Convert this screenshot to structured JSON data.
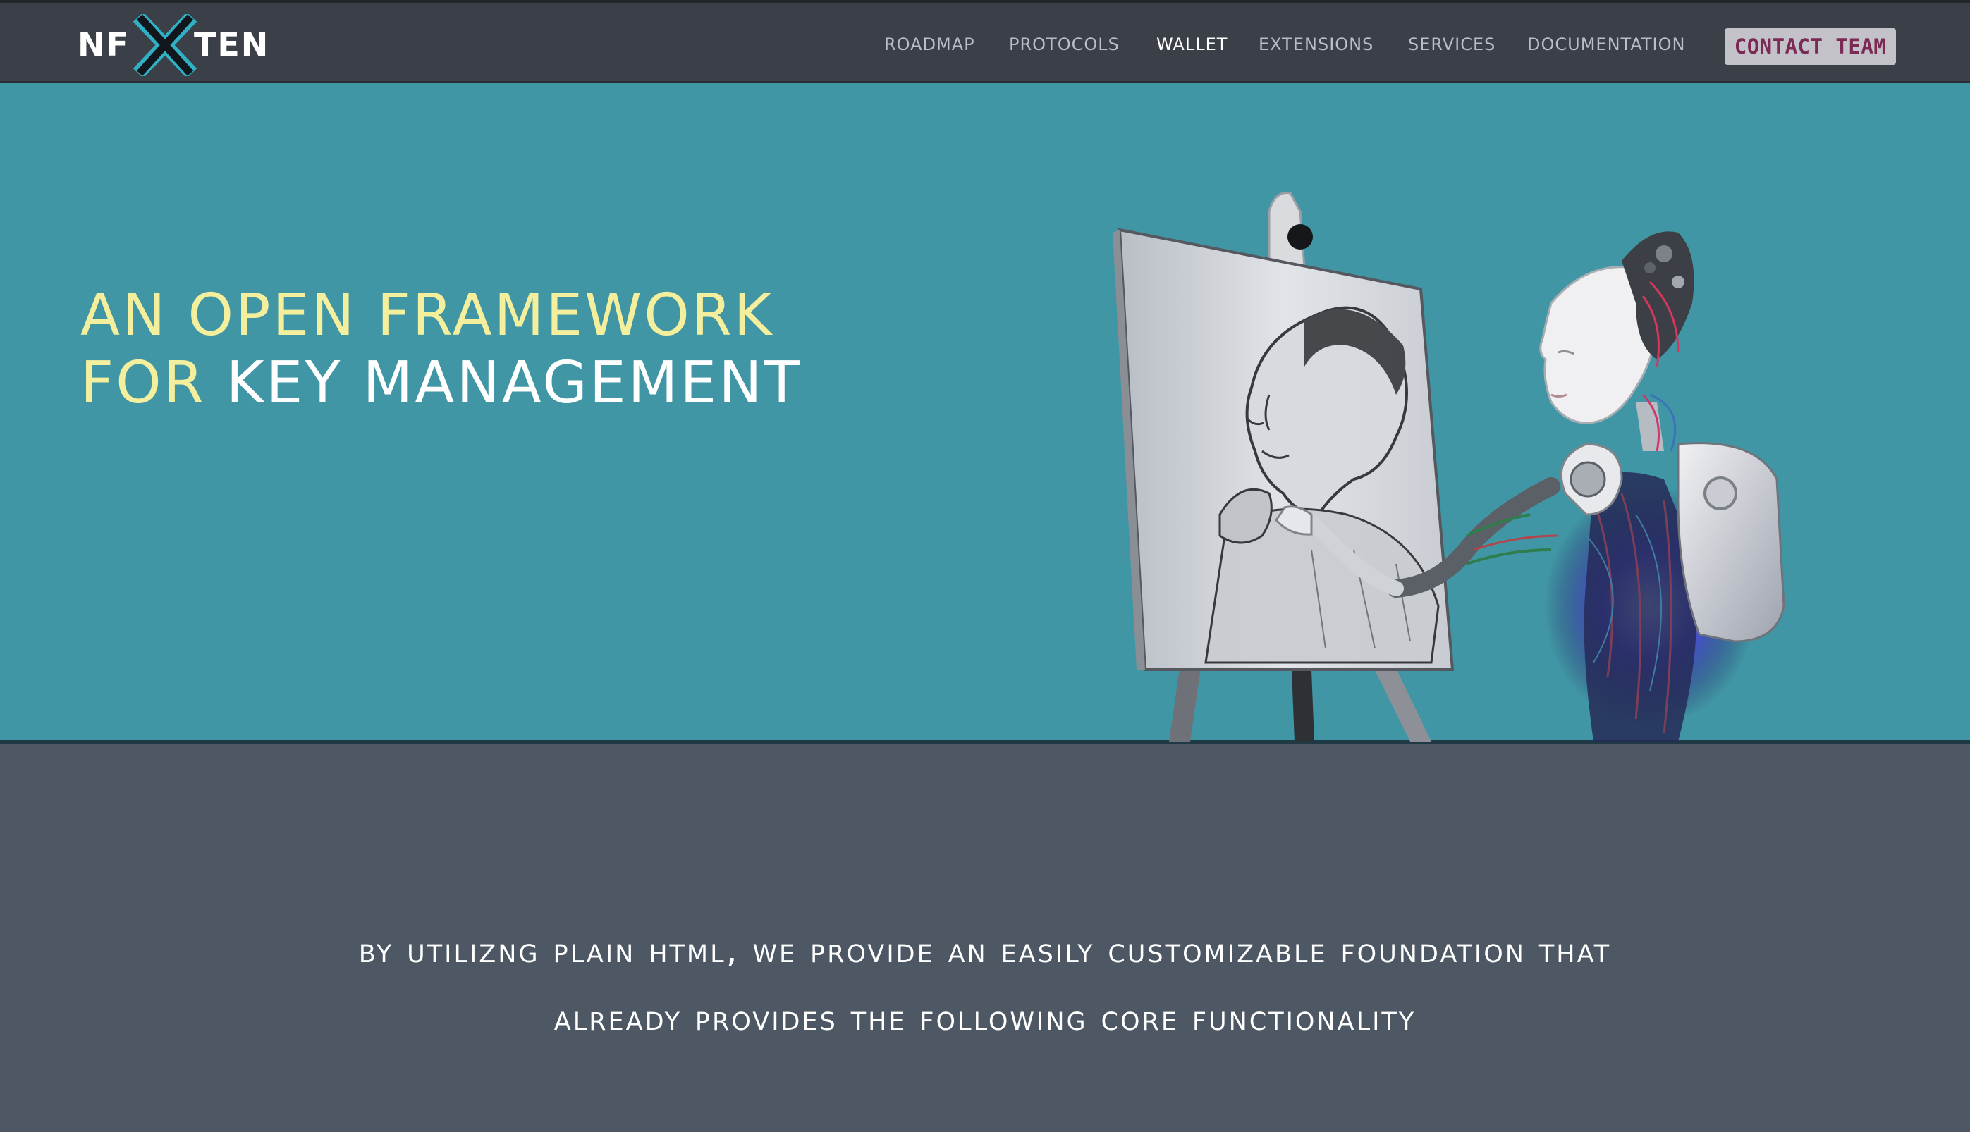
{
  "brand": {
    "logo_left": "NF",
    "logo_right": "TEN"
  },
  "nav": {
    "items": [
      {
        "label": "ROADMAP"
      },
      {
        "label": "PROTOCOLS"
      },
      {
        "label": "WALLET",
        "active": true
      },
      {
        "label": "EXTENSIONS"
      },
      {
        "label": "SERVICES"
      },
      {
        "label": "DOCUMENTATION"
      }
    ],
    "cta_label": "CONTACT TEAM"
  },
  "hero": {
    "headline_line1": "AN OPEN FRAMEWORK",
    "headline_line2_yellow": "FOR ",
    "headline_line2_white": "KEY MANAGEMENT"
  },
  "tagline": {
    "line1": "By utilizng plain HTML, we provide an easily customizable foundation that",
    "line2": "already provides the following core functionality"
  },
  "colors": {
    "nav_bg": "#3b3f47",
    "hero_bg": "#4196a6",
    "lower_bg": "#4e5864",
    "headline_yellow": "#f4ef9c",
    "cta_text": "#7a2a55",
    "cta_bg": "#c3c2c9"
  },
  "icons": [
    "x-logo-icon"
  ]
}
